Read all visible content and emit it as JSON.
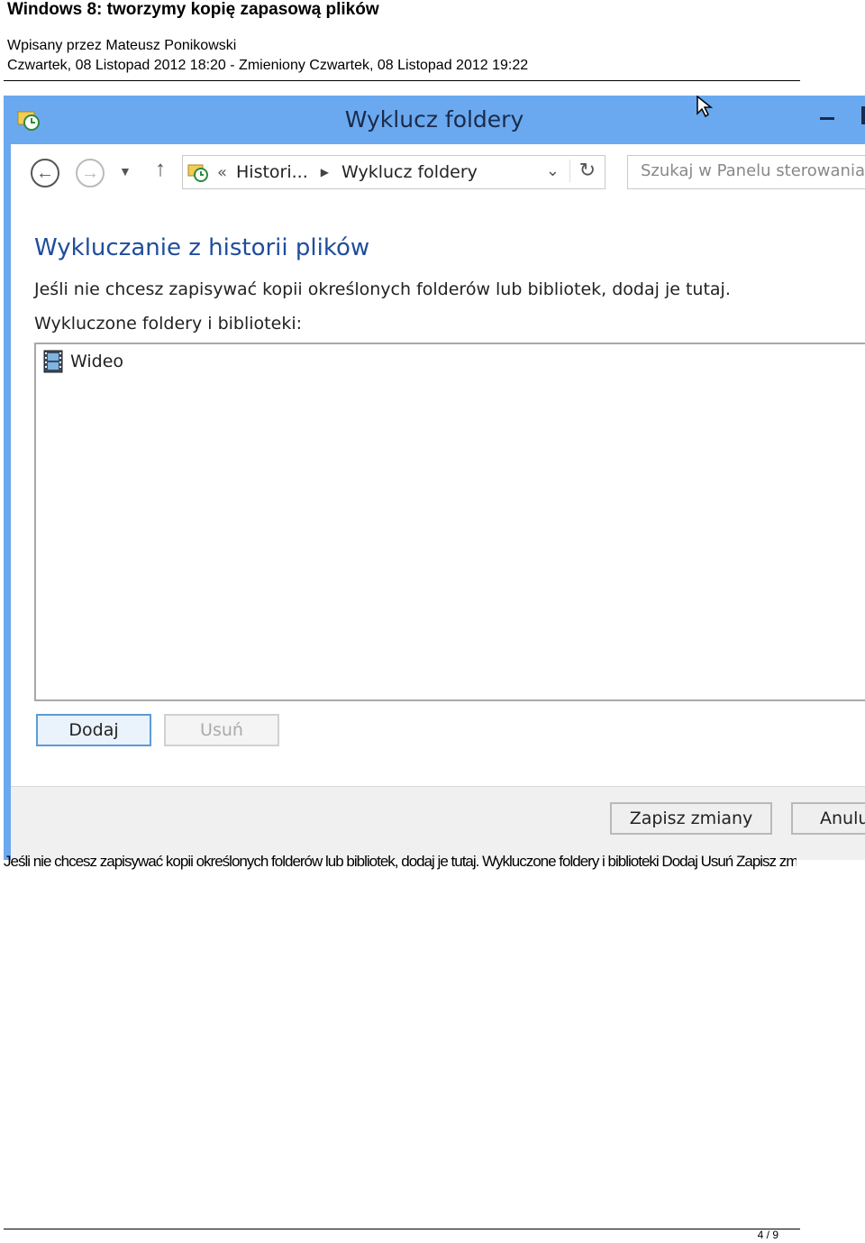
{
  "doc": {
    "title": "Windows 8: tworzymy kopię zapasową plików",
    "author": "Wpisany przez Mateusz Ponikowski",
    "dates": "Czwartek, 08 Listopad 2012 18:20 - Zmieniony Czwartek, 08 Listopad 2012 19:22",
    "page": "4 / 9"
  },
  "window": {
    "title": "Wyklucz foldery",
    "address": {
      "part1": "Histori...",
      "part2": "Wyklucz foldery",
      "overflow": "«"
    },
    "search_placeholder": "Szukaj w Panelu sterowania"
  },
  "content": {
    "heading": "Wykluczanie z historii plików",
    "description": "Jeśli nie chcesz zapisywać kopii określonych folderów lub bibliotek, dodaj je tutaj.",
    "list_label": "Wykluczone foldery i biblioteki:",
    "items": [
      {
        "label": "Wideo"
      }
    ],
    "add_button": "Dodaj",
    "remove_button": "Usuń",
    "save_button": "Zapisz zmiany",
    "cancel_button": "Anulu"
  },
  "overlap_text": "Jeśli nie chcesz zapisywać kopii określonych folderów lub bibliotek, dodaj je tutaj. Wykluczone foldery i biblioteki Dodaj Usuń Zapisz zmiany"
}
